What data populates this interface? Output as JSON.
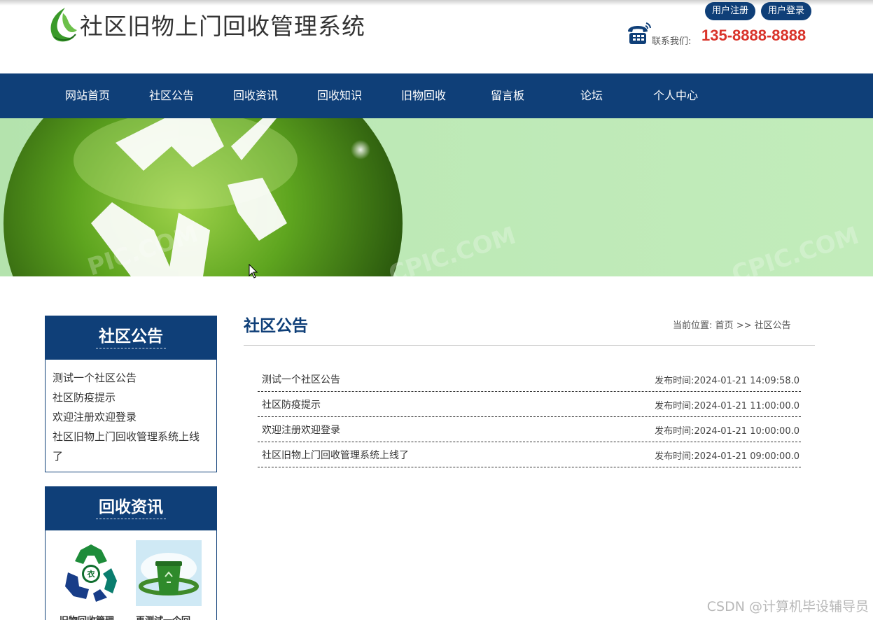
{
  "header": {
    "site_title": "社区旧物上门回收管理系统",
    "register_label": "用户注册",
    "login_label": "用户登录",
    "contact_label": "联系我们:",
    "contact_number": "135-8888-8888"
  },
  "nav": {
    "items": [
      {
        "label": "网站首页"
      },
      {
        "label": "社区公告"
      },
      {
        "label": "回收资讯"
      },
      {
        "label": "回收知识"
      },
      {
        "label": "旧物回收"
      },
      {
        "label": "留言板"
      },
      {
        "label": "论坛"
      },
      {
        "label": "个人中心"
      }
    ]
  },
  "banner": {
    "watermark_text": "CPIC.COM"
  },
  "sidebar": {
    "notices": {
      "title": "社区公告",
      "items": [
        {
          "label": "测试一个社区公告"
        },
        {
          "label": "社区防疫提示"
        },
        {
          "label": "欢迎注册欢迎登录"
        },
        {
          "label": "社区旧物上门回收管理系统上线了"
        }
      ]
    },
    "news": {
      "title": "回收资讯",
      "items": [
        {
          "caption": "旧物回收管理"
        },
        {
          "caption": "再测试一个回"
        }
      ]
    }
  },
  "main": {
    "title": "社区公告",
    "breadcrumb": {
      "prefix": "当前位置:",
      "home": "首页",
      "separator": ">>",
      "current": "社区公告"
    },
    "articles": [
      {
        "title": "测试一个社区公告",
        "date": "发布时间:2024-01-21 14:09:58.0"
      },
      {
        "title": "社区防疫提示",
        "date": "发布时间:2024-01-21 11:00:00.0"
      },
      {
        "title": "欢迎注册欢迎登录",
        "date": "发布时间:2024-01-21 10:00:00.0"
      },
      {
        "title": "社区旧物上门回收管理系统上线了",
        "date": "发布时间:2024-01-21 09:00:00.0"
      }
    ]
  },
  "footer": {
    "watermark": "CSDN @计算机毕设辅导员"
  },
  "colors": {
    "primary": "#0f3f78",
    "accent": "#d9332a",
    "banner_green": "#bde9b6"
  }
}
